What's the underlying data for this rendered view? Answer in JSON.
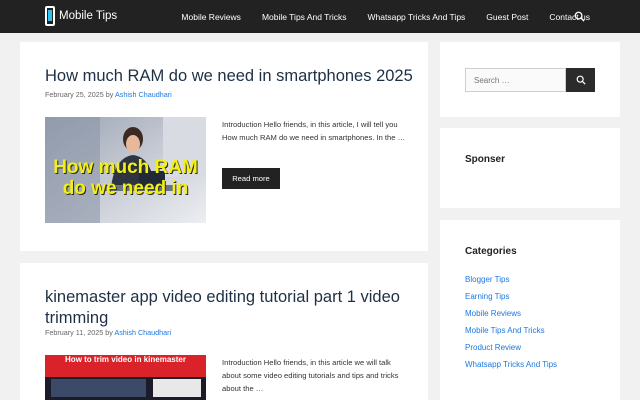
{
  "header": {
    "logo_text": "Mobile Tips",
    "nav": [
      "Mobile Reviews",
      "Mobile Tips And Tricks",
      "Whatsapp Tricks And Tips",
      "Guest Post",
      "Contact us"
    ]
  },
  "posts": [
    {
      "title": "How much RAM do we need in smartphones 2025",
      "date": "February 25, 2025",
      "by": "by",
      "author": "Ashish Chaudhari",
      "thumb_text": "How much RAM do we need in",
      "excerpt": "Introduction Hello friends, in this article, I will tell you How much RAM do we need in smartphones. In the …",
      "read_more": "Read more"
    },
    {
      "title": "kinemaster app video editing tutorial part 1 video trimming",
      "date": "February 11, 2025",
      "by": "by",
      "author": "Ashish Chaudhari",
      "thumb_text": "How to trim video in kinemaster",
      "excerpt": "Introduction Hello friends, in this article we will talk about some video editing tutorials and tips and tricks about the …"
    }
  ],
  "sidebar": {
    "search_placeholder": "Search …",
    "sponser_title": "Sponser",
    "categories_title": "Categories",
    "categories": [
      "Blogger Tips",
      "Earning Tips",
      "Mobile Reviews",
      "Mobile Tips And Tricks",
      "Product Review",
      "Whatsapp Tricks And Tips"
    ]
  },
  "colors": {
    "header_bg": "#222222",
    "link": "#1b78e2",
    "title": "#1e3045",
    "button": "#222222"
  }
}
